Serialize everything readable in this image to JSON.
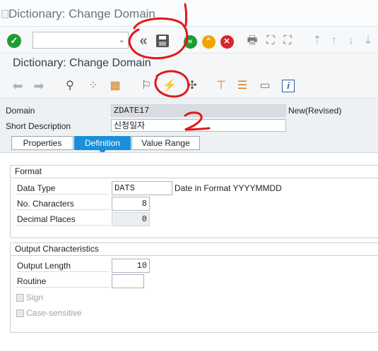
{
  "window": {
    "title": "Dictionary: Change Domain"
  },
  "toolbar": {
    "command_value": "",
    "save_icon": "save-icon",
    "back_icon": "double-chevron-left-icon"
  },
  "screen": {
    "title": "Dictionary: Change Domain"
  },
  "header": {
    "domain_label": "Domain",
    "domain_value": "ZDATE17",
    "domain_status": "New(Revised)",
    "short_desc_label": "Short Description",
    "short_desc_value": "신청일자"
  },
  "tabs": [
    {
      "label": "Properties"
    },
    {
      "label": "Definition"
    },
    {
      "label": "Value Range"
    }
  ],
  "format": {
    "title": "Format",
    "data_type_label": "Data Type",
    "data_type_value": "DATS",
    "data_type_desc": "Date in Format YYYYMMDD",
    "no_chars_label": "No. Characters",
    "no_chars_value": "8",
    "decimals_label": "Decimal Places",
    "decimals_value": "0"
  },
  "output": {
    "title": "Output Characteristics",
    "length_label": "Output Length",
    "length_value": "10",
    "routine_label": "Routine",
    "routine_value": "",
    "sign_label": "Sign",
    "case_label": "Case-sensitive"
  },
  "annotations": {
    "mark_1": "1",
    "mark_2": "2"
  },
  "colors": {
    "active_tab": "#1b8fd8",
    "annotation": "#e01818"
  }
}
